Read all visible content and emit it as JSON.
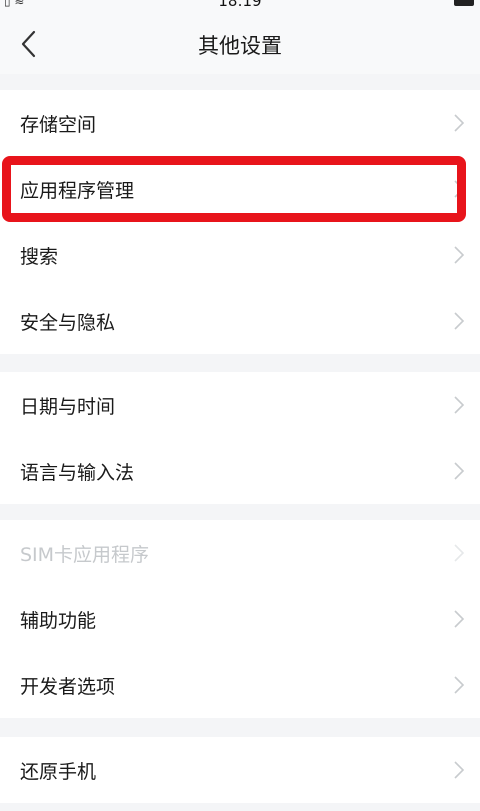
{
  "status_bar": {
    "time": "18:19"
  },
  "header": {
    "title": "其他设置"
  },
  "groups": [
    {
      "items": [
        {
          "label": "存储空间"
        },
        {
          "label": "应用程序管理"
        },
        {
          "label": "搜索"
        },
        {
          "label": "安全与隐私"
        }
      ]
    },
    {
      "items": [
        {
          "label": "日期与时间"
        },
        {
          "label": "语言与输入法"
        }
      ]
    },
    {
      "items": [
        {
          "label": "SIM卡应用程序",
          "disabled": true
        },
        {
          "label": "辅助功能"
        },
        {
          "label": "开发者选项"
        }
      ]
    },
    {
      "items": [
        {
          "label": "还原手机"
        }
      ]
    }
  ],
  "icons": {
    "back": "back-arrow-icon",
    "row_arrow": "chevron-right-icon"
  },
  "colors": {
    "highlight_box": "#e8141b",
    "disabled_text": "#c6c9cc"
  }
}
